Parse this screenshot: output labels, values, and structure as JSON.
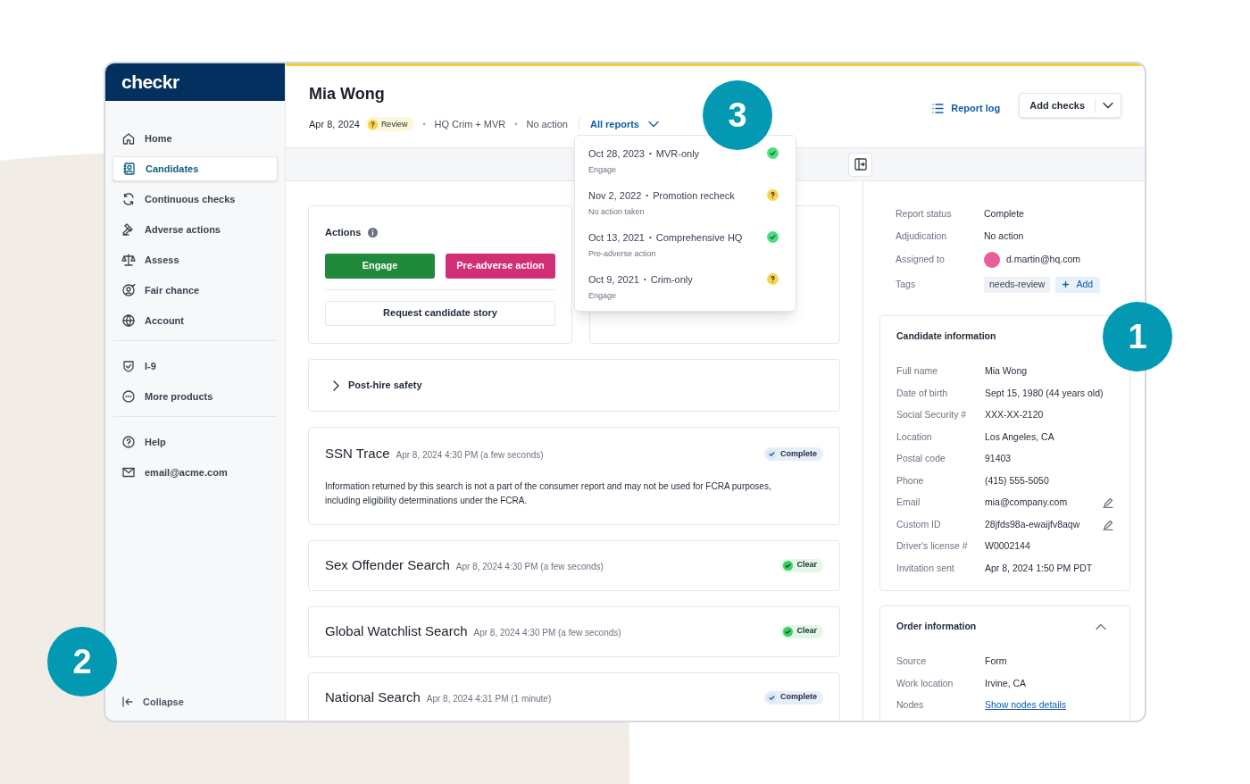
{
  "brand": "checkr",
  "sidebar": {
    "groups": [
      [
        {
          "label": "Home",
          "selected": false
        },
        {
          "label": "Candidates",
          "selected": true
        },
        {
          "label": "Continuous checks",
          "selected": false
        },
        {
          "label": "Adverse actions",
          "selected": false
        },
        {
          "label": "Assess",
          "selected": false
        },
        {
          "label": "Fair chance",
          "selected": false
        },
        {
          "label": "Account",
          "selected": false
        }
      ],
      [
        {
          "label": "I-9",
          "selected": false
        },
        {
          "label": "More products",
          "selected": false
        }
      ],
      [
        {
          "label": "Help",
          "selected": false
        },
        {
          "label": "email@acme.com",
          "selected": false
        }
      ]
    ],
    "collapse": "Collapse"
  },
  "header": {
    "name": "Mia Wong",
    "date": "Apr 8, 2024",
    "status_badge": "Review",
    "package": "HQ Crim + MVR",
    "adjudication": "No action",
    "reports_menu": "All reports",
    "report_log": "Report log",
    "add_checks": "Add checks",
    "separator": "•"
  },
  "reports_dropdown": {
    "expanded": true,
    "items": [
      {
        "date": "Oct 28, 2023",
        "separator": "•",
        "name": "MVR-only",
        "result": "Engage",
        "kind": "complete"
      },
      {
        "date": "Nov 2, 2022",
        "separator": "•",
        "name": "Promotion recheck",
        "result": "No action taken",
        "kind": "review"
      },
      {
        "date": "Oct 13, 2021",
        "separator": "•",
        "name": "Comprehensive HQ",
        "result": "Pre-adverse action",
        "kind": "complete"
      },
      {
        "date": "Oct 9, 2021",
        "separator": "•",
        "name": "Crim-only",
        "result": "Engage",
        "kind": "review"
      }
    ]
  },
  "actions": {
    "title": "Actions",
    "buttons": [
      {
        "label": "Engage",
        "kind": "engage"
      },
      {
        "label": "Pre-adverse action",
        "kind": "adverse"
      },
      {
        "label": "Request candidate story",
        "kind": "outline"
      }
    ]
  },
  "post_hire": {
    "label": "Post-hire safety",
    "expanded": false
  },
  "screenings": [
    {
      "title": "SSN Trace",
      "timestamp": "Apr 8, 2024 4:30 PM (a few seconds)",
      "status": "Complete",
      "kind": "complete",
      "note": "Information returned by this search is not a part of the consumer report and may not be used for FCRA purposes, including eligibility determinations under the FCRA."
    },
    {
      "title": "Sex Offender Search",
      "timestamp": "Apr 8, 2024 4:30 PM (a few seconds)",
      "status": "Clear",
      "kind": "clear"
    },
    {
      "title": "Global Watchlist Search",
      "timestamp": "Apr 8, 2024 4:30 PM (a few seconds)",
      "status": "Clear",
      "kind": "clear"
    },
    {
      "title": "National Search",
      "timestamp": "Apr 8, 2024 4:31 PM (1 minute)",
      "status": "Complete",
      "kind": "complete"
    }
  ],
  "summary": {
    "report_status": {
      "label": "Report status",
      "value": "Complete"
    },
    "adjudication": {
      "label": "Adjudication",
      "value": "No action"
    },
    "assigned_to": {
      "label": "Assigned to",
      "value": "d.martin@hq.com",
      "color": "#e85d9b"
    },
    "tags": {
      "label": "Tags",
      "items": [
        "needs-review"
      ],
      "add": "Add"
    }
  },
  "candidate_information": {
    "title": "Candidate information",
    "fields": [
      {
        "label": "Full name",
        "value": "Mia Wong",
        "editable": false
      },
      {
        "label": "Date of birth",
        "value": "Sept 15, 1980 (44 years old)",
        "editable": false
      },
      {
        "label": "Social Security #",
        "value": "XXX-XX-2120",
        "editable": false
      },
      {
        "label": "Location",
        "value": "Los Angeles, CA",
        "editable": false
      },
      {
        "label": "Postal code",
        "value": "91403",
        "editable": false
      },
      {
        "label": "Phone",
        "value": "(415) 555-5050",
        "editable": false
      },
      {
        "label": "Email",
        "value": "mia@company.com",
        "editable": true
      },
      {
        "label": "Custom ID",
        "value": "28jfds98a-ewaijfv8aqw",
        "editable": true
      },
      {
        "label": "Driver's license #",
        "value": "W0002144",
        "editable": false
      },
      {
        "label": "Invitation sent",
        "value": "Apr 8, 2024 1:50 PM PDT",
        "editable": false
      }
    ]
  },
  "order_information": {
    "title": "Order information",
    "expanded": true,
    "fields": [
      {
        "label": "Source",
        "value": "Form",
        "kind": "text"
      },
      {
        "label": "Work location",
        "value": "Irvine, CA",
        "kind": "text"
      },
      {
        "label": "Nodes",
        "value": "Show nodes details",
        "kind": "link"
      }
    ]
  },
  "callouts": [
    "1",
    "2",
    "3"
  ]
}
